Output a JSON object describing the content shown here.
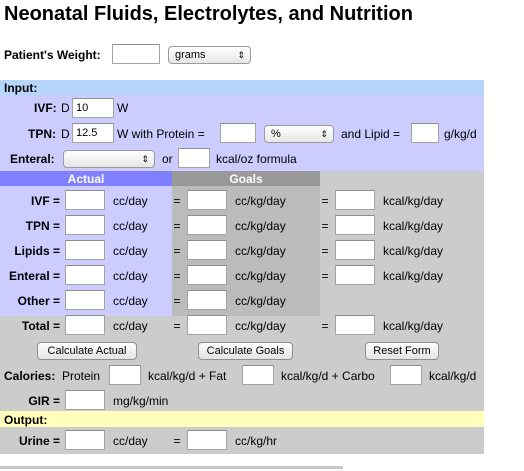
{
  "page": {
    "title": "Neonatal Fluids, Electrolytes, and Nutrition"
  },
  "weight": {
    "label": "Patient's Weight:",
    "value": "",
    "unit_selected": "grams"
  },
  "input_section": {
    "header": "Input:",
    "ivf": {
      "label": "IVF:",
      "prefix": "D",
      "value": "10",
      "suffix": "W"
    },
    "tpn": {
      "label": "TPN:",
      "prefix": "D",
      "value": "12.5",
      "with_protein_label": "W with Protein =",
      "protein_value": "",
      "protein_unit_selected": "%",
      "lipid_label": "and Lipid =",
      "lipid_value": "",
      "lipid_unit": "g/kg/d"
    },
    "enteral": {
      "label": "Enteral:",
      "formula_selected": "",
      "or_label": "or",
      "kcal_value": "",
      "kcal_unit": "kcal/oz formula"
    }
  },
  "grid": {
    "actual_header": "Actual",
    "goals_header": "Goals",
    "eq": "=",
    "unit_ccday": "cc/day",
    "unit_cckgday": "cc/kg/day",
    "unit_kcal": "kcal/kg/day",
    "rows": [
      {
        "label": "IVF ="
      },
      {
        "label": "TPN ="
      },
      {
        "label": "Lipids ="
      },
      {
        "label": "Enteral ="
      },
      {
        "label": "Other ="
      },
      {
        "label": "Total ="
      }
    ]
  },
  "buttons": {
    "calc_actual": "Calculate Actual",
    "calc_goals": "Calculate Goals",
    "reset": "Reset Form"
  },
  "calories": {
    "label": "Calories:",
    "protein_label": "Protein",
    "fat_label": "kcal/kg/d + Fat",
    "carbo_label": "kcal/kg/d + Carbo",
    "end_label": "kcal/kg/d"
  },
  "gir": {
    "label": "GIR =",
    "unit": "mg/kg/min"
  },
  "output_section": {
    "header": "Output:",
    "urine": {
      "label": "Urine =",
      "unit_ccday": "cc/day",
      "eq": "=",
      "unit_cckghr": "cc/kg/hr"
    }
  },
  "colors": {
    "input_header": "#b6d6fb",
    "lavender": "#ccccff",
    "actual_header": "#8080ff",
    "goals_header": "#999999",
    "goals_band": "#bbbbbb",
    "grey_band": "#cccccc",
    "output_header": "#ffffbb"
  }
}
